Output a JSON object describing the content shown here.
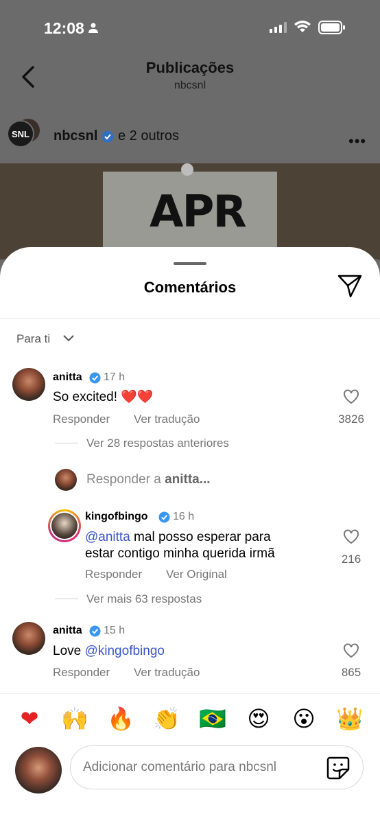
{
  "status_bar": {
    "time": "12:08"
  },
  "topbar": {
    "title": "Publicações",
    "subtitle": "nbcsnl"
  },
  "post": {
    "avatar_text": "SNL",
    "username": "nbcsnl",
    "others": "e 2 outros",
    "image_text": "APR"
  },
  "sheet": {
    "title": "Comentários",
    "filter": "Para ti"
  },
  "comments": [
    {
      "username": "anitta",
      "time": "17 h",
      "text": "So excited! ❤️❤️",
      "reply_label": "Responder",
      "translate_label": "Ver tradução",
      "likes": "3826",
      "thread_label": "Ver 28 respostas anteriores"
    },
    {
      "reply_prompt_prefix": "Responder a ",
      "reply_prompt_user": "anitta..."
    },
    {
      "username": "kingofbingo",
      "time": "16 h",
      "mention": "@anitta",
      "text_line1": " mal posso esperar para",
      "text_line2": "estar contigo minha querida irmã",
      "reply_label": "Responder",
      "translate_label": "Ver Original",
      "likes": "216",
      "thread_label": "Ver mais 63 respostas"
    },
    {
      "username": "anitta",
      "time": "15 h",
      "text_prefix": "Love ",
      "mention": "@kingofbingo",
      "reply_label": "Responder",
      "translate_label": "Ver tradução",
      "likes": "865"
    }
  ],
  "emoji_bar": [
    "❤",
    "🙌",
    "🔥",
    "👏",
    "🇧🇷",
    "😍",
    "😮",
    "👑"
  ],
  "composer": {
    "placeholder": "Adicionar comentário para nbcsnl"
  },
  "colors": {
    "mention": "#3a55c9",
    "verified": "#3897f0"
  }
}
